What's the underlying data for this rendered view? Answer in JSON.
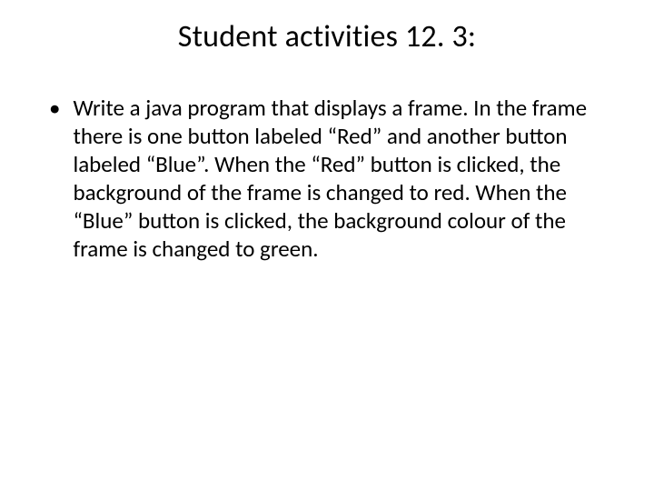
{
  "slide": {
    "title": "Student activities 12. 3:",
    "bullets": [
      {
        "text": "Write a java program that displays a frame. In the frame there is one button labeled “Red” and another button labeled “Blue”. When the “Red” button is clicked, the background of the frame is changed to red. When the “Blue” button is clicked, the background colour of the frame is changed to green."
      }
    ],
    "bullet_marker": "•"
  }
}
